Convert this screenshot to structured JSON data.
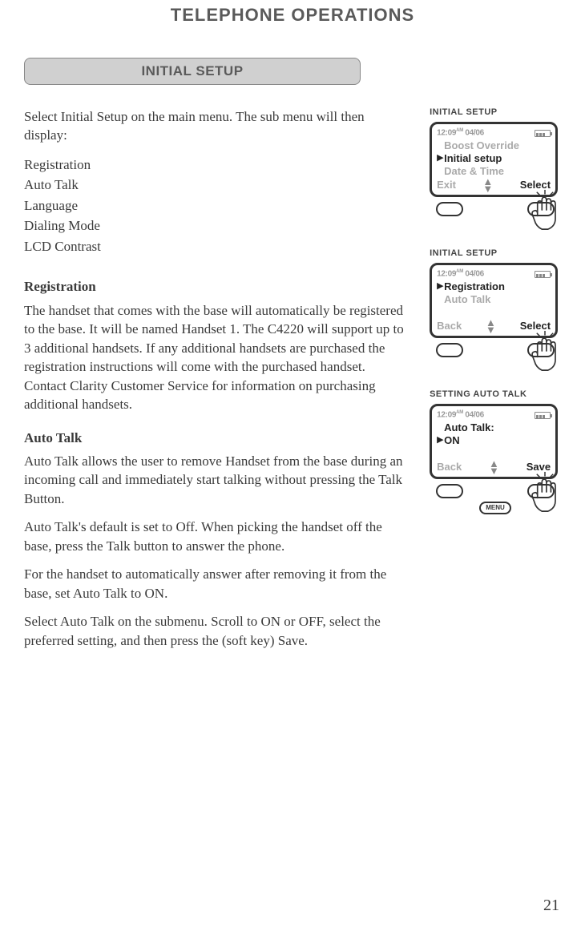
{
  "page_title": "TELEPHONE OPERATIONS",
  "section_tab": "INITIAL SETUP",
  "page_number": "21",
  "left": {
    "intro": "Select Initial Setup on the main menu. The sub menu will then display:",
    "menu_items": [
      "Registration",
      "Auto Talk",
      "Language",
      "Dialing Mode",
      "LCD Contrast"
    ],
    "reg_head": "Registration",
    "reg_body": "The handset that comes with the base will automatically be registered to the base. It will be named Handset 1. The C4220 will support up to 3 additional handsets. If any additional handsets are purchased the registration instructions will come with the purchased handset. Contact Clarity Customer Service for information on purchasing additional handsets.",
    "auto_head": "Auto Talk",
    "auto_p1": "Auto Talk allows the user to remove Handset from the base during an incoming call and immediately start talking without pressing the Talk Button.",
    "auto_p2": "Auto Talk's default is set to Off.  When picking the handset off the base, press the Talk button to answer the phone.",
    "auto_p3": "For the handset to automatically answer after removing it from the base, set Auto Talk to ON.",
    "auto_p4": "Select Auto Talk on the submenu. Scroll to ON or OFF, select the preferred setting, and then press the (soft key) Save."
  },
  "screens": [
    {
      "title": "INITIAL SETUP",
      "time": "12:09",
      "ampm": "AM",
      "date": "04/06",
      "lines": [
        {
          "text": "Boost Override",
          "sel": false
        },
        {
          "text": "Initial setup",
          "sel": true
        },
        {
          "text": "Date & Time",
          "sel": false
        }
      ],
      "left_soft": "Exit",
      "right_soft": "Select",
      "show_menu": false
    },
    {
      "title": "INITIAL SETUP",
      "time": "12:09",
      "ampm": "AM",
      "date": "04/06",
      "lines": [
        {
          "text": "Registration",
          "sel": true
        },
        {
          "text": "Auto Talk",
          "sel": false
        },
        {
          "text": "",
          "sel": false
        }
      ],
      "left_soft": "Back",
      "right_soft": "Select",
      "show_menu": false
    },
    {
      "title": "SETTING AUTO TALK",
      "time": "12:09",
      "ampm": "AM",
      "date": "04/06",
      "lines": [
        {
          "text": "Auto Talk:",
          "sel": false,
          "bold": true
        },
        {
          "text": "ON",
          "sel": true
        },
        {
          "text": "",
          "sel": false
        }
      ],
      "left_soft": "Back",
      "right_soft": "Save",
      "show_menu": true
    }
  ]
}
